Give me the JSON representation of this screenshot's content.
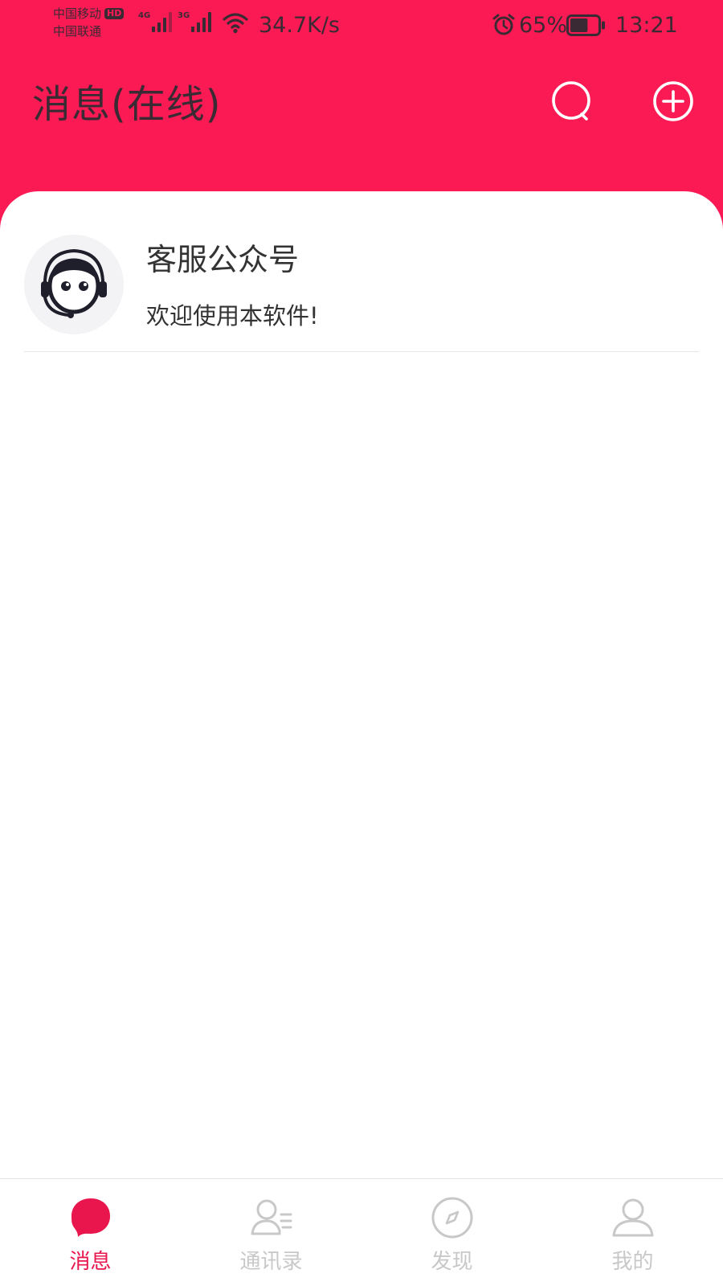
{
  "status_bar": {
    "carrier_1": "中国移动",
    "carrier_1_badge": "HD",
    "carrier_2": "中国联通",
    "signal_1_type": "4G",
    "signal_2_type": "3G",
    "net_speed": "34.7K/s",
    "battery_percent": "65%",
    "battery_level": 0.65,
    "time": "13:21",
    "icons": [
      "signal-icon",
      "wifi-icon",
      "alarm-icon",
      "battery-icon"
    ]
  },
  "header": {
    "title": "消息(在线)",
    "icons": [
      "search-icon",
      "add-circle-icon"
    ]
  },
  "conversations": [
    {
      "title": "客服公众号",
      "preview": "欢迎使用本软件!",
      "avatar_icon": "customer-service-avatar-icon"
    }
  ],
  "bottom_nav": {
    "items": [
      {
        "label": "消息",
        "icon": "message-bubble-icon",
        "active": true
      },
      {
        "label": "通讯录",
        "icon": "contacts-icon",
        "active": false
      },
      {
        "label": "发现",
        "icon": "compass-icon",
        "active": false
      },
      {
        "label": "我的",
        "icon": "user-icon",
        "active": false
      }
    ]
  },
  "colors": {
    "header_bg": "#fb1a54",
    "header_text": "#3a2a33",
    "nav_active": "#e8164c",
    "nav_inactive": "#c8c8c8",
    "text_primary": "#333333"
  }
}
